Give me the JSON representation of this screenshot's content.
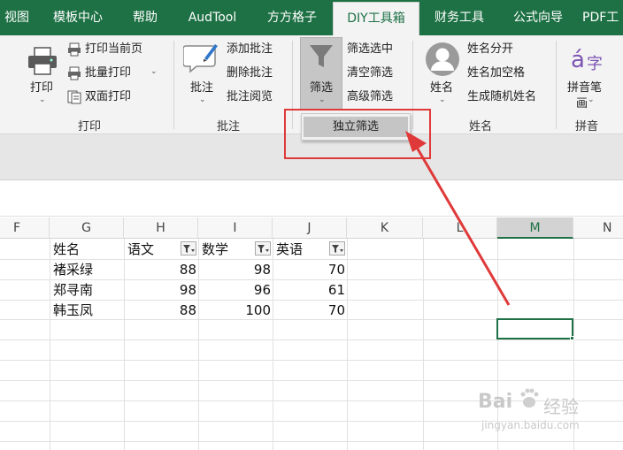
{
  "tabs": [
    {
      "label": "视图",
      "active": false
    },
    {
      "label": "模板中心",
      "active": false
    },
    {
      "label": "帮助",
      "active": false
    },
    {
      "label": "AudTool",
      "active": false
    },
    {
      "label": "方方格子",
      "active": false
    },
    {
      "label": "DIY工具箱",
      "active": true
    },
    {
      "label": "财务工具",
      "active": false
    },
    {
      "label": "公式向导",
      "active": false
    },
    {
      "label": "PDF工",
      "active": false
    }
  ],
  "ribbon": {
    "print_group": {
      "label": "打印",
      "print_button": "打印",
      "print_current_page": "打印当前页",
      "batch_print": "批量打印",
      "duplex_print": "双面打印"
    },
    "comment_group": {
      "label": "批注",
      "comment_button": "批注",
      "add_comment": "添加批注",
      "delete_comment": "删除批注",
      "review_comment": "批注阅览"
    },
    "filter_group": {
      "filter_button": "筛选",
      "filter_selected": "筛选选中",
      "clear_filter": "清空筛选",
      "advanced_filter": "高级筛选",
      "dropdown_item": "独立筛选"
    },
    "name_group": {
      "label": "姓名",
      "name_button": "姓名",
      "split_name": "姓名分开",
      "add_space": "姓名加空格",
      "random_name": "生成随机姓名"
    },
    "pinyin_group": {
      "label": "拼音",
      "pinyin_button_line1": "拼音笔",
      "pinyin_button_line2": "画"
    }
  },
  "grid": {
    "columns": [
      "F",
      "G",
      "H",
      "I",
      "J",
      "K",
      "L",
      "M",
      "N"
    ],
    "selected_column": "M",
    "headers": [
      "姓名",
      "语文",
      "数学",
      "英语"
    ],
    "rows": [
      {
        "name": "褚采绿",
        "chinese": "88",
        "math": "98",
        "english": "70"
      },
      {
        "name": "郑寻南",
        "chinese": "98",
        "math": "96",
        "english": "61"
      },
      {
        "name": "韩玉凤",
        "chinese": "88",
        "math": "100",
        "english": "70"
      }
    ]
  },
  "watermark": {
    "line1": "Bai",
    "line2": "经验",
    "line3": "jingyan.baidu.com"
  },
  "colors": {
    "accent": "#1e7145",
    "annotation": "#e0393a"
  }
}
